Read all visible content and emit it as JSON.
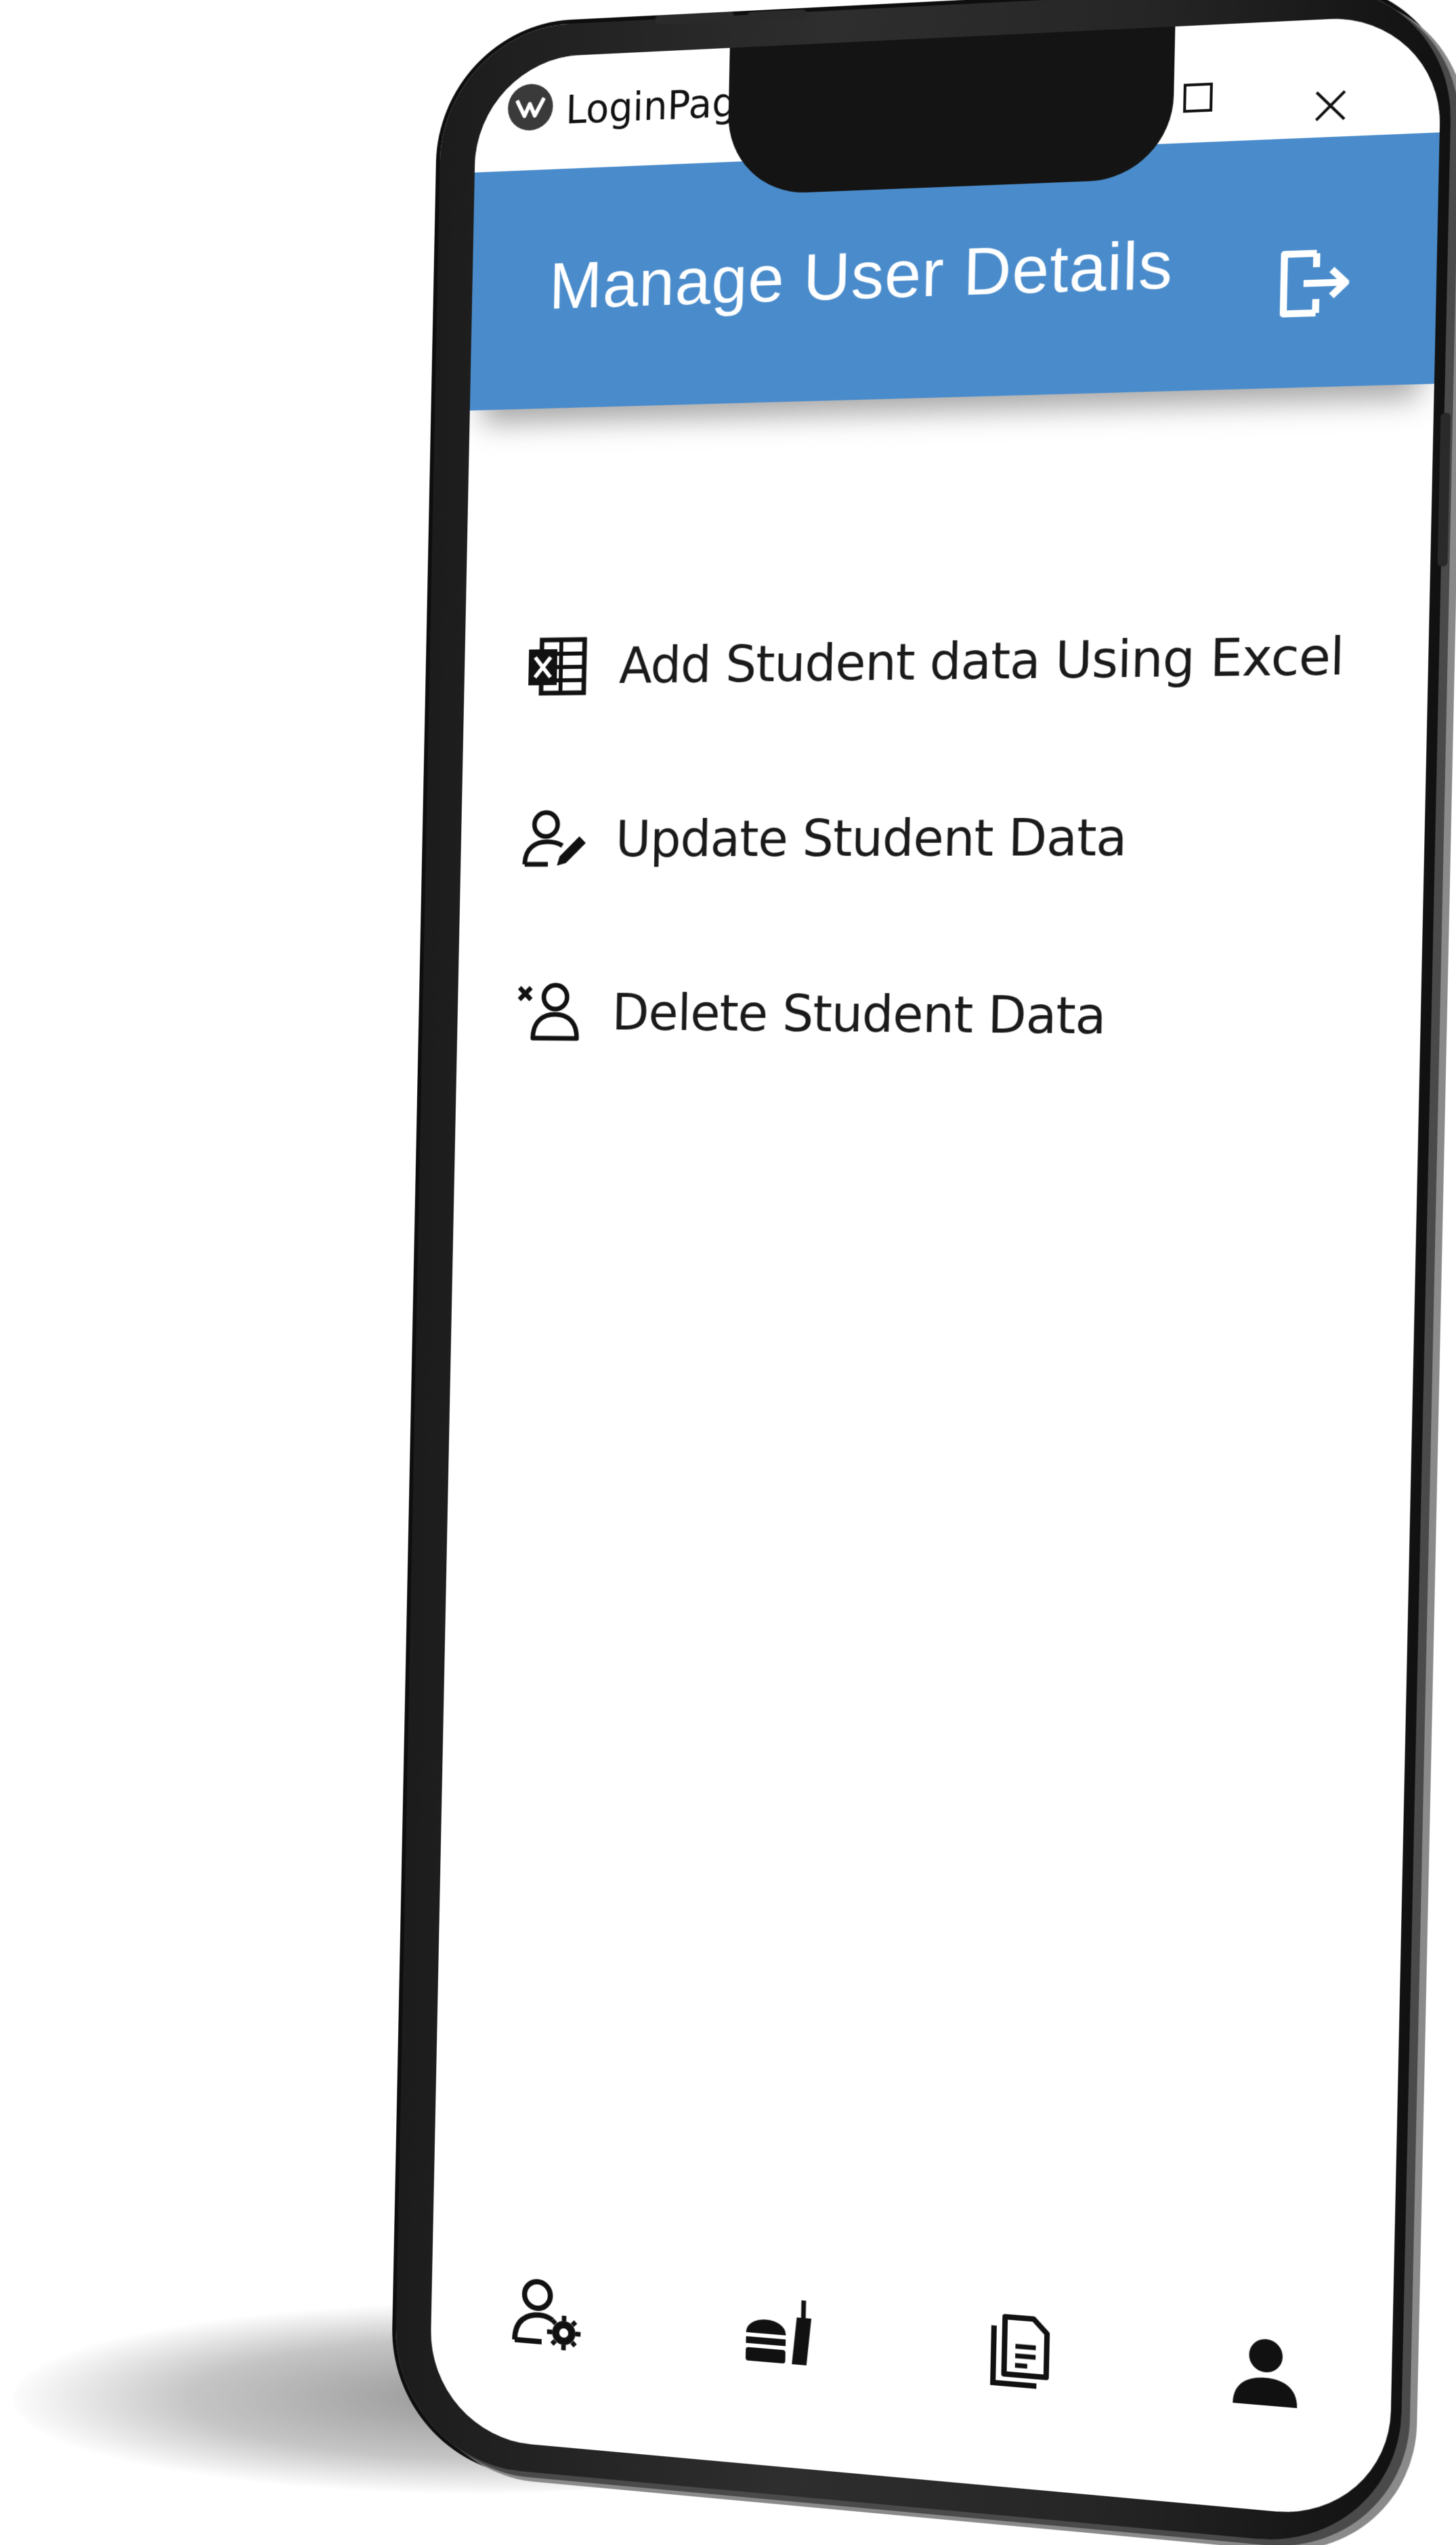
{
  "window": {
    "title": "LoginPage",
    "logo_icon": "app-logo-icon",
    "controls": [
      "maximize-icon",
      "close-icon"
    ]
  },
  "appbar": {
    "title": "Manage User Details",
    "color": "#4a8ccb",
    "logout_icon": "logout-icon"
  },
  "menu": {
    "items": [
      {
        "label": "Add Student data Using Excel",
        "icon": "excel-icon"
      },
      {
        "label": "Update Student Data",
        "icon": "user-edit-icon"
      },
      {
        "label": "Delete Student Data",
        "icon": "user-remove-icon"
      }
    ]
  },
  "bottom_nav": {
    "items": [
      {
        "icon": "user-settings-icon"
      },
      {
        "icon": "food-icon"
      },
      {
        "icon": "documents-icon"
      },
      {
        "icon": "person-icon"
      }
    ]
  }
}
